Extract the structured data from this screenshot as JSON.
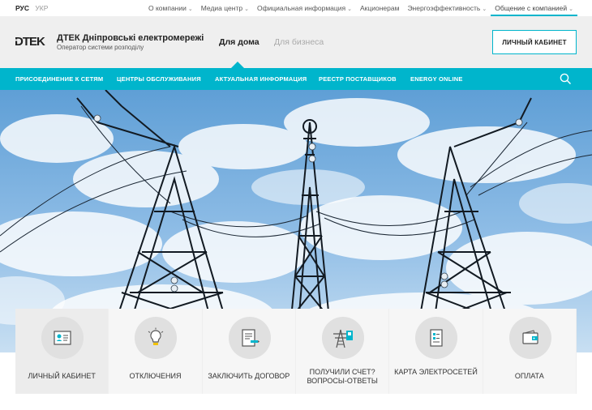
{
  "lang": {
    "active": "РУС",
    "inactive": "УКР"
  },
  "toplinks": [
    {
      "label": "О компании",
      "has_dropdown": true
    },
    {
      "label": "Медиа центр",
      "has_dropdown": true
    },
    {
      "label": "Официальная информация",
      "has_dropdown": true
    },
    {
      "label": "Акционерам",
      "has_dropdown": false
    },
    {
      "label": "Энергоэффективность",
      "has_dropdown": true
    },
    {
      "label": "Общение с компанией",
      "has_dropdown": true
    }
  ],
  "brand": {
    "name": "ДТЕК Дніпровські електромережі",
    "subtitle": "Оператор системи розподілу"
  },
  "segments": {
    "home": "Для дома",
    "business": "Для бизнеса"
  },
  "cabinet_button": "ЛИЧНЫЙ КАБИНЕТ",
  "nav": [
    "ПРИСОЕДИНЕНИЕ К СЕТЯМ",
    "ЦЕНТРЫ ОБСЛУЖИВАНИЯ",
    "АКТУАЛЬНАЯ ИНФОРМАЦИЯ",
    "РЕЕСТР ПОСТАВЩИКОВ",
    "ENERGY ONLINE"
  ],
  "tiles": [
    {
      "label": "ЛИЧНЫЙ КАБИНЕТ",
      "icon": "id-card-icon"
    },
    {
      "label": "ОТКЛЮЧЕНИЯ",
      "icon": "lightbulb-icon"
    },
    {
      "label": "ЗАКЛЮЧИТЬ ДОГОВОР",
      "icon": "contract-pen-icon"
    },
    {
      "label": "ПОЛУЧИЛИ СЧЕТ? ВОПРОСЫ-ОТВЕТЫ",
      "icon": "power-tower-icon"
    },
    {
      "label": "КАРТА ЭЛЕКТРОСЕТЕЙ",
      "icon": "map-document-icon"
    },
    {
      "label": "ОПЛАТА",
      "icon": "wallet-icon"
    }
  ],
  "colors": {
    "accent": "#00b5cc",
    "header_bg": "#efefef",
    "tile_bg": "#f6f6f6"
  }
}
